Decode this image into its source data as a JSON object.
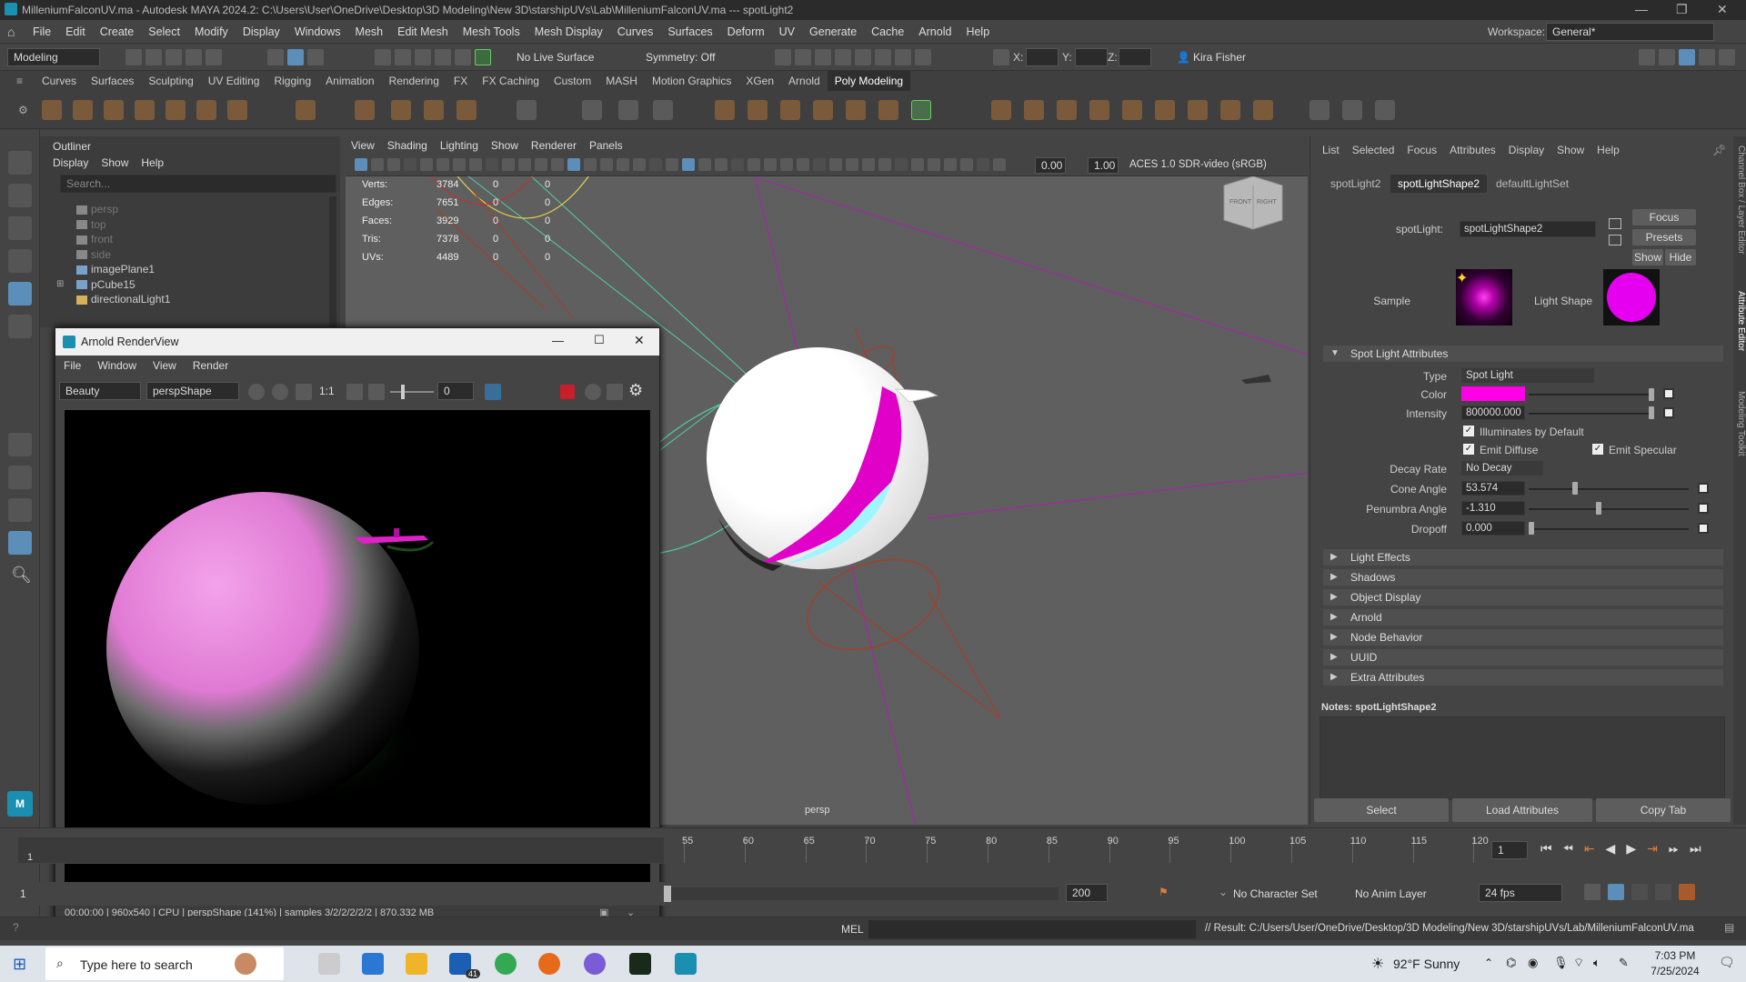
{
  "window": {
    "title": "MilleniumFalconUV.ma - Autodesk MAYA 2024.2: C:\\Users\\User\\OneDrive\\Desktop\\3D Modeling\\New 3D\\starshipUVs\\Lab\\MilleniumFalconUV.ma  ---  spotLight2"
  },
  "menu": [
    "File",
    "Edit",
    "Create",
    "Select",
    "Modify",
    "Display",
    "Windows",
    "Mesh",
    "Edit Mesh",
    "Mesh Tools",
    "Mesh Display",
    "Curves",
    "Surfaces",
    "Deform",
    "UV",
    "Generate",
    "Cache",
    "Arnold",
    "Help"
  ],
  "workspace": {
    "label": "Workspace:",
    "value": "General*"
  },
  "statusline": {
    "mode": "Modeling",
    "live_surface": "No Live Surface",
    "symmetry": "Symmetry: Off",
    "x": "X:",
    "y": "Y:",
    "z": "Z:",
    "user": "Kira Fisher"
  },
  "shelf_tabs": [
    "Curves",
    "Surfaces",
    "Sculpting",
    "UV Editing",
    "Rigging",
    "Animation",
    "Rendering",
    "FX",
    "FX Caching",
    "Custom",
    "MASH",
    "Motion Graphics",
    "XGen",
    "Arnold",
    "Poly Modeling"
  ],
  "shelf_active": "Poly Modeling",
  "outliner": {
    "title": "Outliner",
    "menu": [
      "Display",
      "Show",
      "Help"
    ],
    "search_placeholder": "Search...",
    "items": [
      "persp",
      "top",
      "front",
      "side",
      "imagePlane1",
      "pCube15",
      "directionalLight1"
    ]
  },
  "viewport": {
    "menu": [
      "View",
      "Shading",
      "Lighting",
      "Show",
      "Renderer",
      "Panels"
    ],
    "exposure": "0.00",
    "gamma": "1.00",
    "colorspace": "ACES 1.0 SDR-video (sRGB)",
    "camera_label": "persp",
    "cube_front": "FRONT",
    "cube_right": "RIGHT",
    "stats": [
      {
        "label": "Verts:",
        "a": "3784",
        "b": "0",
        "c": "0"
      },
      {
        "label": "Edges:",
        "a": "7651",
        "b": "0",
        "c": "0"
      },
      {
        "label": "Faces:",
        "a": "3929",
        "b": "0",
        "c": "0"
      },
      {
        "label": "Tris:",
        "a": "7378",
        "b": "0",
        "c": "0"
      },
      {
        "label": "UVs:",
        "a": "4489",
        "b": "0",
        "c": "0"
      }
    ]
  },
  "renderview": {
    "title": "Arnold RenderView",
    "menu": [
      "File",
      "Window",
      "View",
      "Render"
    ],
    "aov": "Beauty",
    "camera": "perspShape",
    "ratio": "1:1",
    "exposure": "0",
    "status": "00:00:00 | 960x540 | CPU | perspShape (141%) | samples 3/2/2/2/2/2 | 870.332 MB"
  },
  "attribute_editor": {
    "menu": [
      "List",
      "Selected",
      "Focus",
      "Attributes",
      "Display",
      "Show",
      "Help"
    ],
    "tabs": [
      "spotLight2",
      "spotLightShape2",
      "defaultLightSet"
    ],
    "active_tab": "spotLightShape2",
    "node_label": "spotLight:",
    "node_name": "spotLightShape2",
    "focus": "Focus",
    "presets": "Presets",
    "show": "Show",
    "hide": "Hide",
    "sample_label": "Sample",
    "light_shape_label": "Light Shape",
    "section_spot": "Spot Light Attributes",
    "type_label": "Type",
    "type_value": "Spot Light",
    "color_label": "Color",
    "color_value": "#ff00e6",
    "intensity_label": "Intensity",
    "intensity_value": "800000.000",
    "illuminates": "Illuminates by Default",
    "emit_diffuse": "Emit Diffuse",
    "emit_specular": "Emit Specular",
    "decay_label": "Decay Rate",
    "decay_value": "No Decay",
    "cone_label": "Cone Angle",
    "cone_value": "53.574",
    "penumbra_label": "Penumbra Angle",
    "penumbra_value": "-1.310",
    "dropoff_label": "Dropoff",
    "dropoff_value": "0.000",
    "sections": [
      "Light Effects",
      "Shadows",
      "Object Display",
      "Arnold",
      "Node Behavior",
      "UUID",
      "Extra Attributes"
    ],
    "notes": "Notes:  spotLightShape2",
    "buttons": [
      "Select",
      "Load Attributes",
      "Copy Tab"
    ],
    "side_tabs": [
      "Channel Box / Layer Editor",
      "Attribute Editor",
      "Modeling Toolkit"
    ]
  },
  "timeline": {
    "ticks": [
      "55",
      "60",
      "65",
      "70",
      "75",
      "80",
      "85",
      "90",
      "95",
      "100",
      "105",
      "110",
      "115",
      "120"
    ],
    "current": "1",
    "range_start": "1",
    "range_end": "200",
    "character_set": "No Character Set",
    "anim_layer": "No Anim Layer",
    "fps": "24 fps",
    "left_frame": "1"
  },
  "cmdline": {
    "lang": "MEL",
    "result": "// Result: C:/Users/User/OneDrive/Desktop/3D Modeling/New 3D/starshipUVs/Lab/MilleniumFalconUV.ma"
  },
  "taskbar": {
    "search": "Type here to search",
    "weather": "92°F  Sunny",
    "time": "7:03 PM",
    "date": "7/25/2024",
    "mail_badge": "41"
  }
}
